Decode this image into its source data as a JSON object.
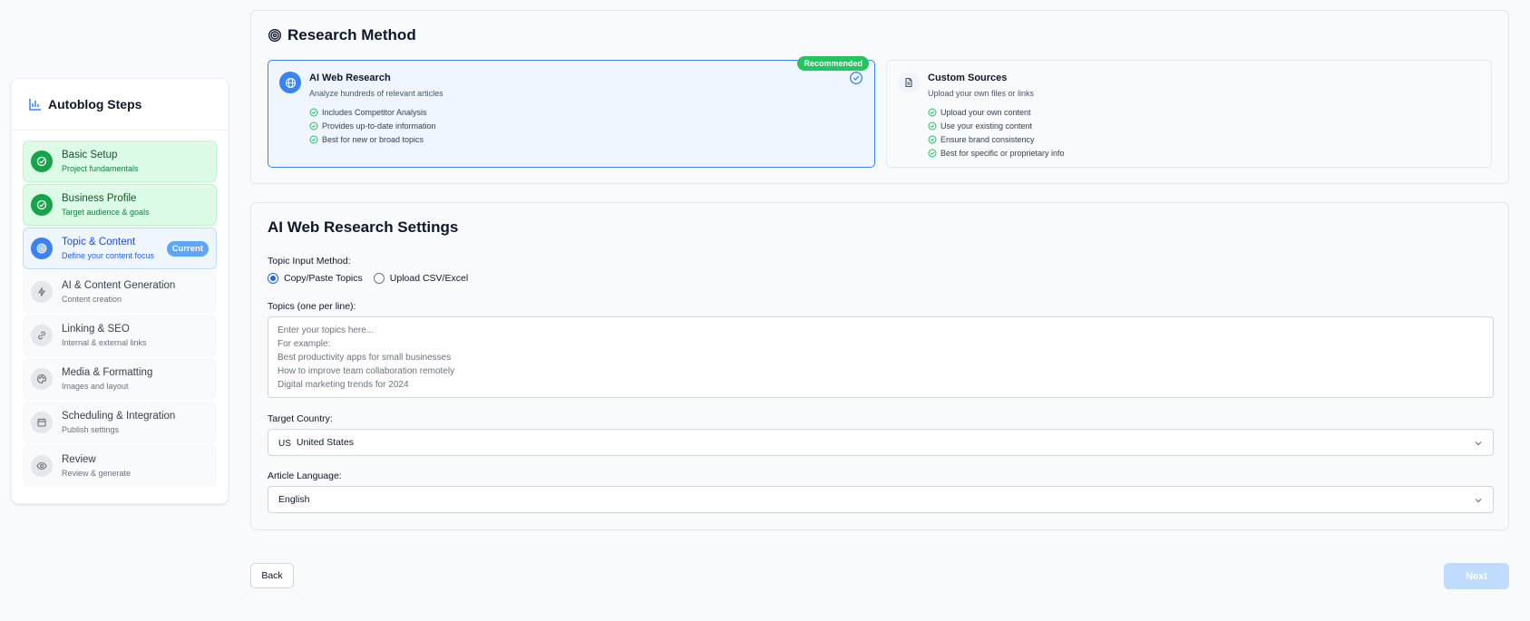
{
  "sidebar": {
    "title": "Autoblog Steps",
    "steps": [
      {
        "label": "Basic Setup",
        "sub": "Project fundamentals",
        "status": "done"
      },
      {
        "label": "Business Profile",
        "sub": "Target audience & goals",
        "status": "done"
      },
      {
        "label": "Topic & Content",
        "sub": "Define your content focus",
        "status": "current",
        "badge": "Current"
      },
      {
        "label": "AI & Content Generation",
        "sub": "Content creation",
        "status": "pending"
      },
      {
        "label": "Linking & SEO",
        "sub": "Internal & external links",
        "status": "pending"
      },
      {
        "label": "Media & Formatting",
        "sub": "Images and layout",
        "status": "pending"
      },
      {
        "label": "Scheduling & Integration",
        "sub": "Publish settings",
        "status": "pending"
      },
      {
        "label": "Review",
        "sub": "Review & generate",
        "status": "pending"
      }
    ]
  },
  "research_method": {
    "title": "Research Method",
    "options": {
      "ai": {
        "title": "AI Web Research",
        "desc": "Analyze hundreds of relevant articles",
        "badge": "Recommended",
        "features": [
          "Includes Competitor Analysis",
          "Provides up-to-date information",
          "Best for new or broad topics"
        ]
      },
      "custom": {
        "title": "Custom Sources",
        "desc": "Upload your own files or links",
        "features": [
          "Upload your own content",
          "Use your existing content",
          "Ensure brand consistency",
          "Best for specific or proprietary info"
        ]
      }
    }
  },
  "settings": {
    "title": "AI Web Research Settings",
    "topic_input_label": "Topic Input Method:",
    "radio_copy": "Copy/Paste Topics",
    "radio_upload": "Upload CSV/Excel",
    "topics_label": "Topics (one per line):",
    "topics_placeholder": "Enter your topics here...\nFor example:\nBest productivity apps for small businesses\nHow to improve team collaboration remotely\nDigital marketing trends for 2024",
    "country_label": "Target Country:",
    "country_flag": "US",
    "country_value": "United States",
    "language_label": "Article Language:",
    "language_value": "English"
  },
  "nav": {
    "back": "Back",
    "next": "Next"
  },
  "colors": {
    "primary": "#3b82f6",
    "success": "#16a34a",
    "recommended": "#22c55e",
    "next_disabled": "#bfdbfe"
  }
}
